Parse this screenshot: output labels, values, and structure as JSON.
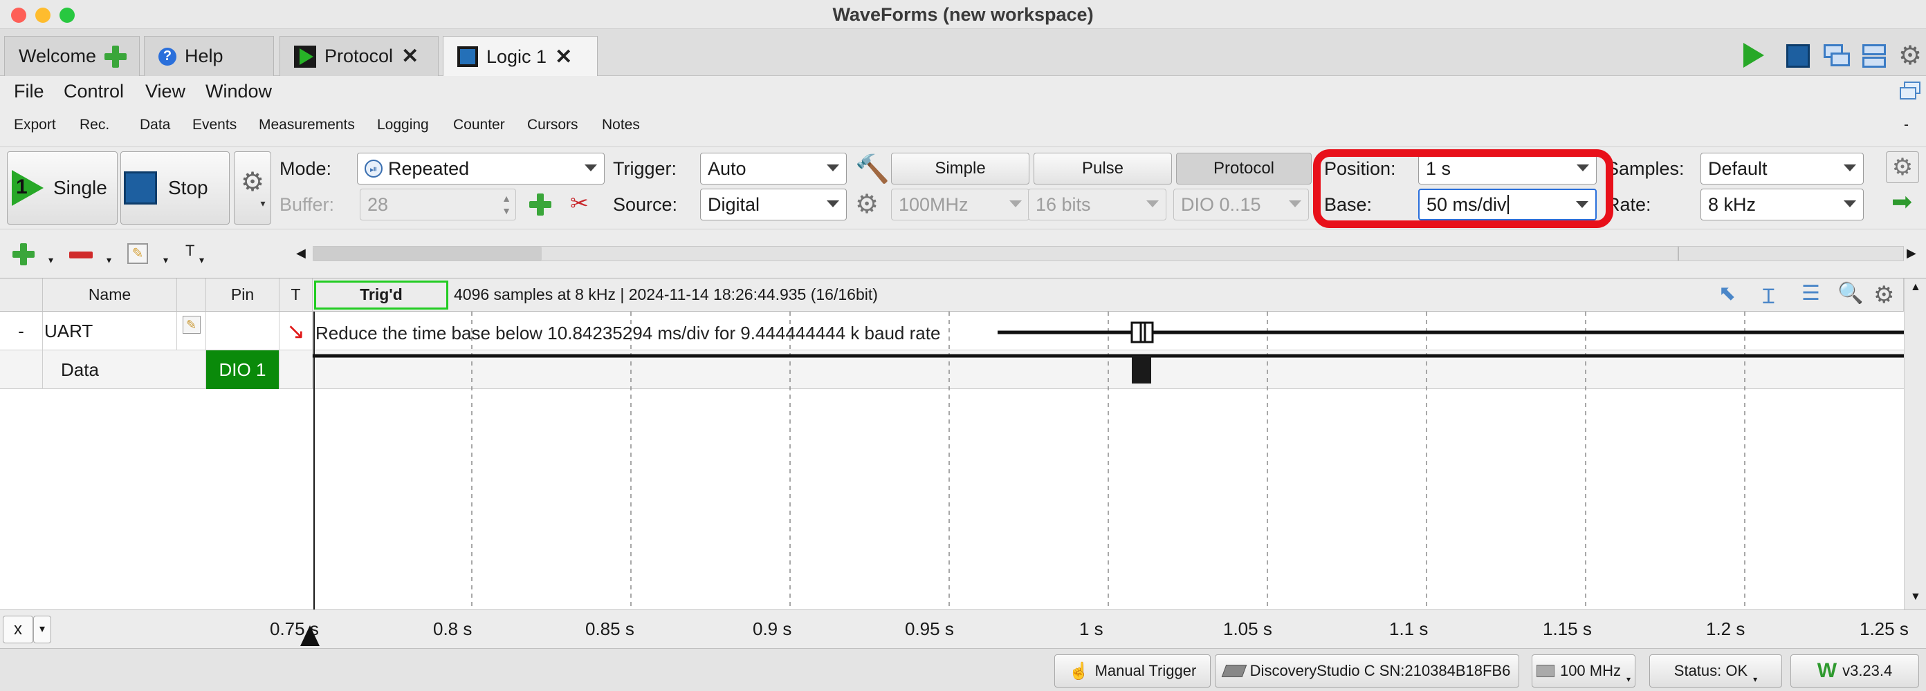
{
  "window": {
    "title": "WaveForms (new workspace)"
  },
  "tabs": [
    {
      "label": "Welcome",
      "icon": "plus-icon"
    },
    {
      "label": "Help",
      "icon": "help-icon"
    },
    {
      "label": "Protocol",
      "icon": "play-icon"
    },
    {
      "label": "Logic 1",
      "icon": "logic-icon",
      "active": true
    }
  ],
  "menu": [
    "File",
    "Control",
    "View",
    "Window"
  ],
  "submenu": [
    "Export",
    "Rec.",
    "Data",
    "Events",
    "Measurements",
    "Logging",
    "Counter",
    "Cursors",
    "Notes"
  ],
  "submenu_collapse": "-",
  "control": {
    "single_label": "Single",
    "single_number": "1",
    "stop_label": "Stop",
    "mode_label": "Mode:",
    "mode_value": "Repeated",
    "buffer_label": "Buffer:",
    "buffer_value": "28",
    "trigger_label": "Trigger:",
    "trigger_value": "Auto",
    "source_label": "Source:",
    "source_value": "Digital",
    "simple_label": "Simple",
    "pulse_label": "Pulse",
    "protocol_label": "Protocol",
    "clock_value": "100MHz",
    "bits_value": "16 bits",
    "dio_range_value": "DIO 0..15",
    "position_label": "Position:",
    "position_value": "1 s",
    "base_label": "Base:",
    "base_value": "50 ms/div",
    "samples_label": "Samples:",
    "samples_value": "Default",
    "rate_label": "Rate:",
    "rate_value": "8 kHz"
  },
  "chantoolbar": {
    "text_tool": "T"
  },
  "table": {
    "headers": {
      "name": "Name",
      "pin": "Pin",
      "t": "T",
      "trig": "Trig'd"
    },
    "info": "4096 samples at 8 kHz | 2024-11-14 18:26:44.935 (16/16bit)",
    "rows": [
      {
        "expander": "-",
        "name": "UART",
        "pin": "",
        "warning": "Reduce the time base below 10.84235294 ms/div for 9.444444444 k baud rate"
      },
      {
        "expander": "",
        "name": "Data",
        "pin": "DIO 1"
      }
    ]
  },
  "axis": {
    "unit_button": "x",
    "ticks": [
      "0.75 s",
      "0.8 s",
      "0.85 s",
      "0.9 s",
      "0.95 s",
      "1 s",
      "1.05 s",
      "1.1 s",
      "1.15 s",
      "1.2 s",
      "1.25 s"
    ]
  },
  "status": {
    "manual_trigger": "Manual Trigger",
    "device": "DiscoveryStudio C SN:210384B18FB6",
    "clock": "100 MHz",
    "status": "Status: OK",
    "version": "v3.23.4"
  },
  "colors": {
    "highlight": "#e8101a",
    "green": "#3aa63a",
    "dio_pin": "#0a8a0a",
    "trig_border": "#22cc22"
  }
}
